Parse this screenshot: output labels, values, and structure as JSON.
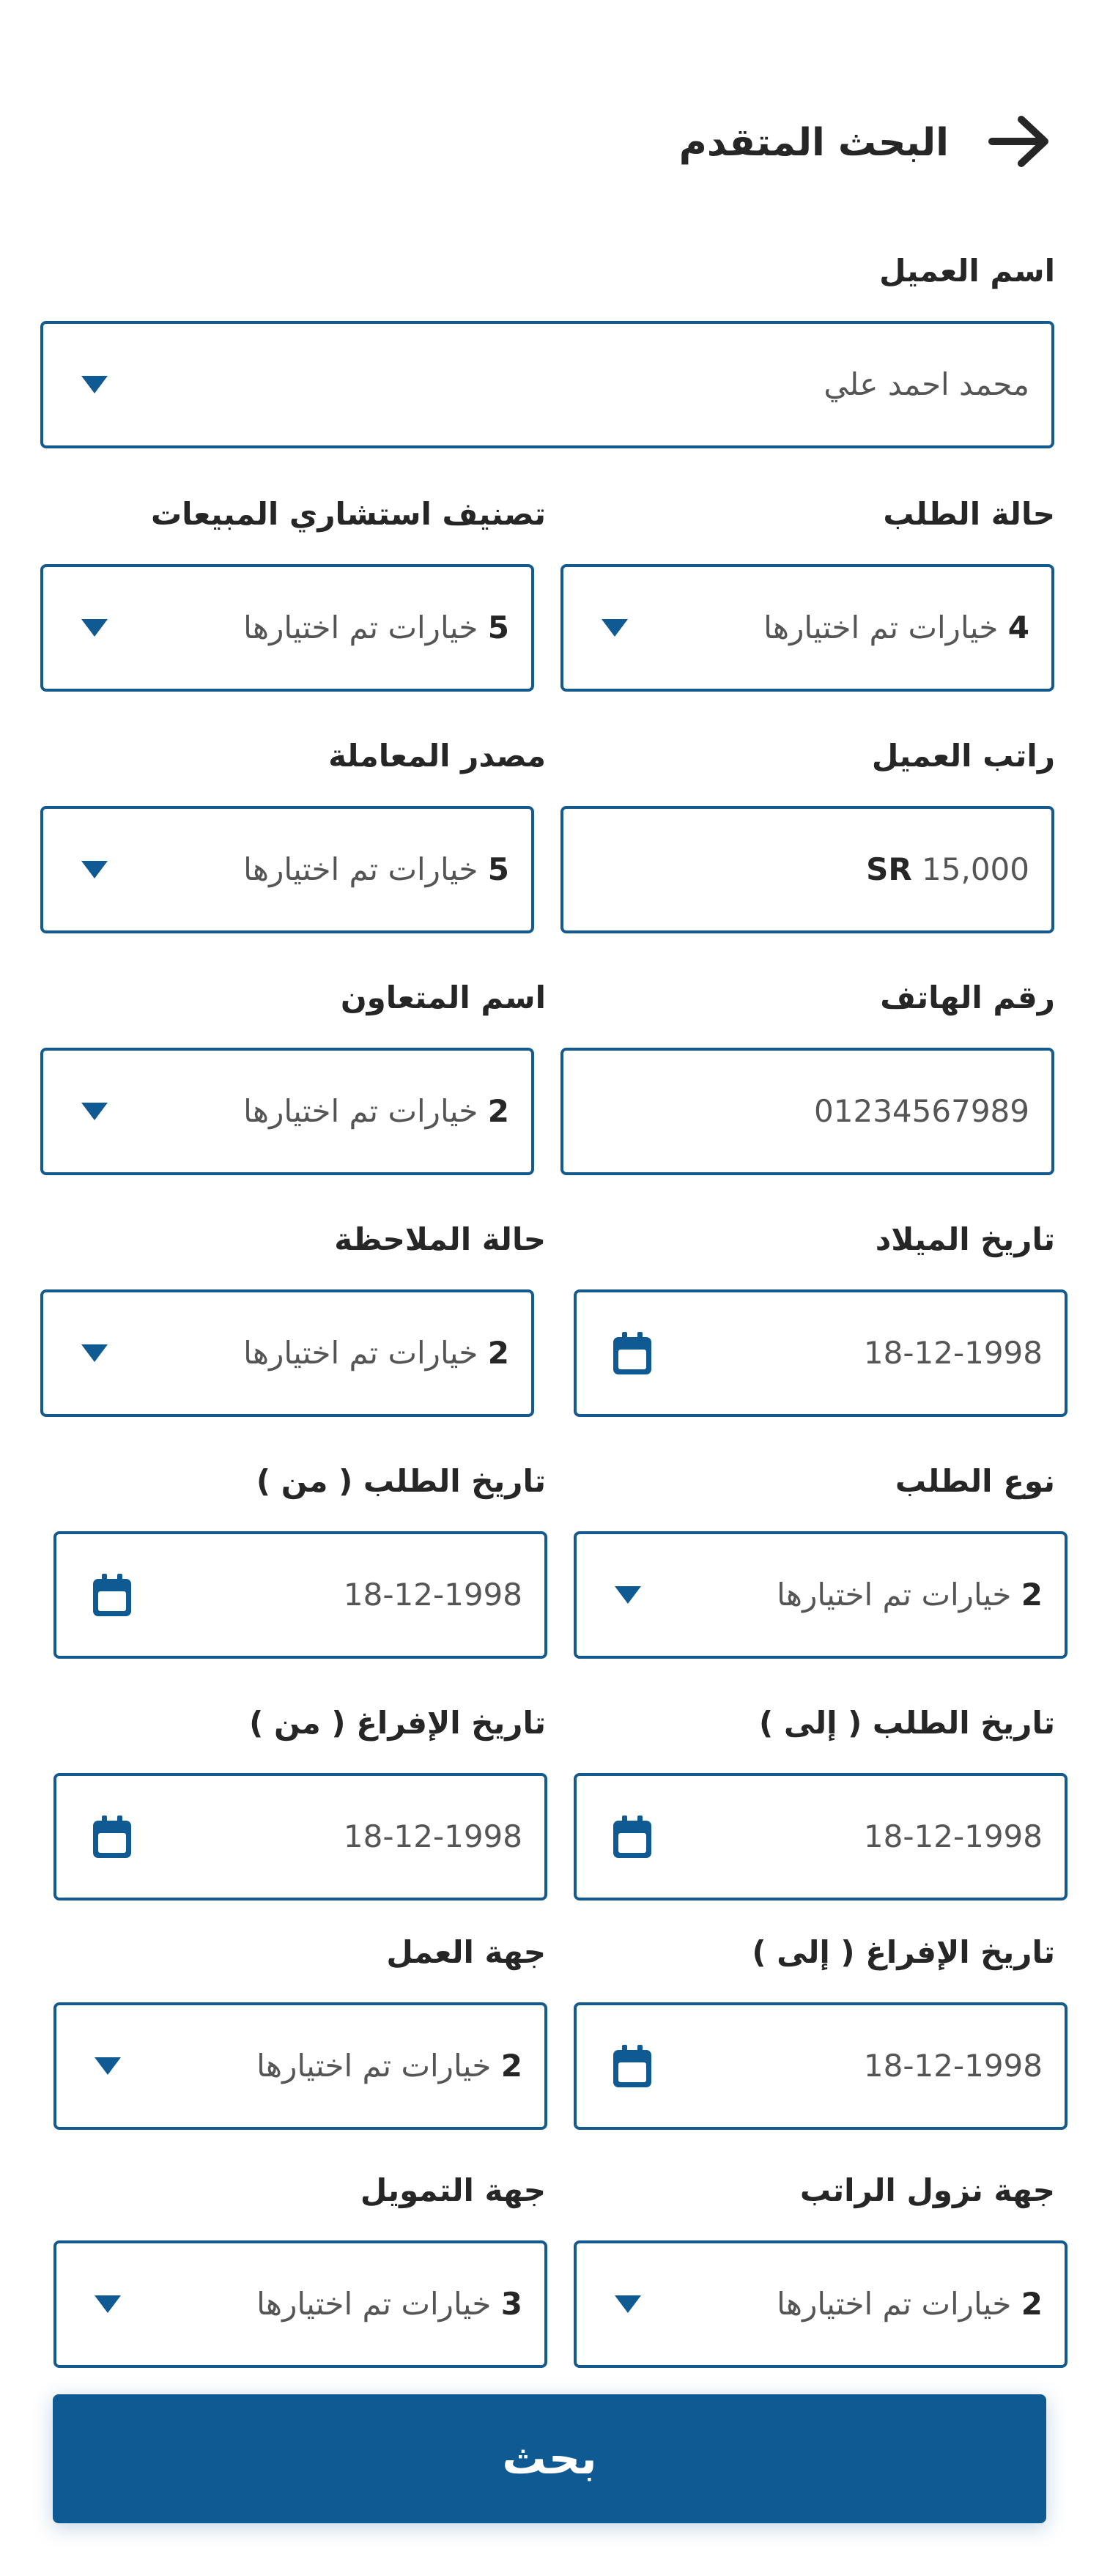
{
  "header": {
    "title": "البحث المتقدم",
    "back_icon": "arrow-right-icon"
  },
  "colors": {
    "primary": "#0f5a93",
    "border": "#155a8e",
    "text": "#262626",
    "muted_text": "#555555"
  },
  "selected_suffix": "خيارات تم اختيارها",
  "fields": {
    "customer_name": {
      "label": "اسم العميل",
      "value": "محمد احمد علي",
      "icon": "caret-down-icon"
    },
    "request_status": {
      "label": "حالة الطلب",
      "count": "4",
      "icon": "caret-down-icon"
    },
    "sales_consultant_class": {
      "label": "تصنيف استشاري المبيعات",
      "count": "5",
      "icon": "caret-down-icon"
    },
    "customer_salary": {
      "label": "راتب العميل",
      "currency": "SR",
      "value": "15,000"
    },
    "transaction_source": {
      "label": "مصدر المعاملة",
      "count": "5",
      "icon": "caret-down-icon"
    },
    "phone_number": {
      "label": "رقم الهاتف",
      "value": "01234567989"
    },
    "collaborator_name": {
      "label": "اسم المتعاون",
      "count": "2",
      "icon": "caret-down-icon"
    },
    "birth_date": {
      "label": "تاريخ الميلاد",
      "value": "18-12-1998",
      "icon": "calendar-icon"
    },
    "note_status": {
      "label": "حالة الملاحظة",
      "count": "2",
      "icon": "caret-down-icon"
    },
    "request_type": {
      "label": "نوع الطلب",
      "count": "2",
      "icon": "caret-down-icon"
    },
    "request_date_from": {
      "label": "تاريخ الطلب ( من )",
      "value": "18-12-1998",
      "icon": "calendar-icon"
    },
    "request_date_to": {
      "label": "تاريخ الطلب ( إلى )",
      "value": "18-12-1998",
      "icon": "calendar-icon"
    },
    "release_date_from": {
      "label": "تاريخ الإفراغ ( من )",
      "value": "18-12-1998",
      "icon": "calendar-icon"
    },
    "release_date_to": {
      "label": "تاريخ الإفراغ ( إلى )",
      "value": "18-12-1998",
      "icon": "calendar-icon"
    },
    "employer": {
      "label": "جهة العمل",
      "count": "2",
      "icon": "caret-down-icon"
    },
    "salary_deposit_bank": {
      "label": "جهة نزول الراتب",
      "count": "2",
      "icon": "caret-down-icon"
    },
    "funding_entity": {
      "label": "جهة التمويل",
      "count": "3",
      "icon": "caret-down-icon"
    }
  },
  "actions": {
    "search_label": "بحث"
  }
}
